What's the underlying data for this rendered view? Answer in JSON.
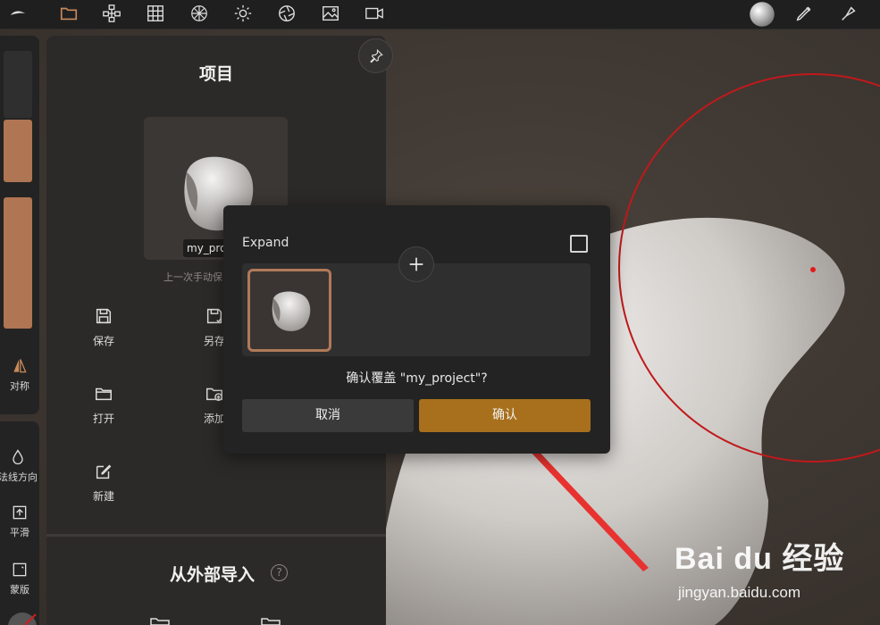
{
  "toolbar": {
    "icons": [
      "logo-icon",
      "folder-icon",
      "scene-icon",
      "grid-icon",
      "topology-icon",
      "light-icon",
      "render-icon",
      "image-icon",
      "video-icon",
      "matcap-sphere-icon",
      "brush-icon",
      "paint-icon"
    ],
    "accent": "#c98a5a"
  },
  "sidebar": {
    "symmetry_label": "对称",
    "normal_label": "法线方向",
    "smooth_label": "平滑",
    "mask_label": "蒙版"
  },
  "panel": {
    "title": "项目",
    "project_name": "my_pro",
    "last_save": "上一次手动保",
    "actions": {
      "save": "保存",
      "save_as": "另存",
      "open": "打开",
      "add": "添加",
      "new": "新建"
    },
    "import_title": "从外部导入",
    "help": "?"
  },
  "dialog": {
    "expand_label": "Expand",
    "message": "确认覆盖 \"my_project\"?",
    "cancel_label": "取消",
    "confirm_label": "确认",
    "confirm_color": "#a8701c"
  },
  "watermark": {
    "brand": "Bai  du 经验",
    "url": "jingyan.baidu.com"
  }
}
